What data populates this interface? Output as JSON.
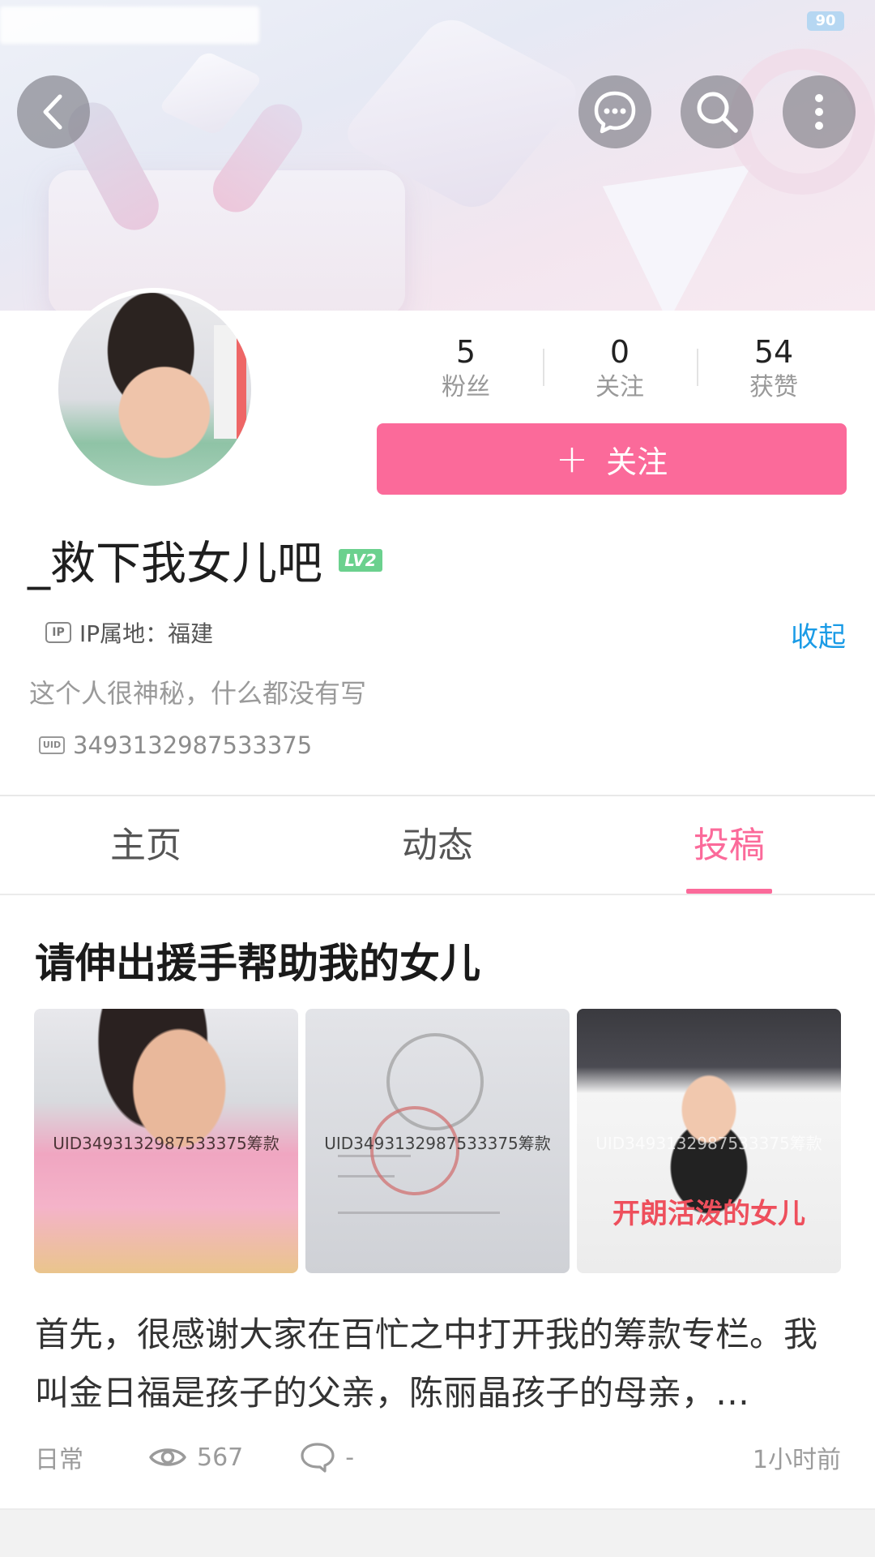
{
  "status_bar": {
    "battery": "90"
  },
  "header": {
    "icons": [
      "back-icon",
      "message-icon",
      "search-icon",
      "more-icon"
    ]
  },
  "profile": {
    "stats": [
      {
        "value": "5",
        "label": "粉丝"
      },
      {
        "value": "0",
        "label": "关注"
      },
      {
        "value": "54",
        "label": "获赞"
      }
    ],
    "follow_button": {
      "icon": "+",
      "label": "关注"
    },
    "username": "_救下我女儿吧",
    "level": "LV2",
    "ip_icon": "IP",
    "ip_location": "IP属地：福建",
    "collapse_label": "收起",
    "bio": "这个人很神秘，什么都没有写",
    "uid_icon": "UID",
    "uid": "3493132987533375"
  },
  "tabs": [
    {
      "label": "主页",
      "active": false
    },
    {
      "label": "动态",
      "active": false
    },
    {
      "label": "投稿",
      "active": true
    }
  ],
  "post": {
    "title": "请伸出援手帮助我的女儿",
    "images": [
      {
        "watermark": "UID3493132987533375筹款",
        "caption": ""
      },
      {
        "watermark": "UID3493132987533375筹款",
        "caption": ""
      },
      {
        "watermark": "UID3493132987533375筹款",
        "caption": "开朗活泼的女儿"
      }
    ],
    "excerpt": "首先，很感谢大家在百忙之中打开我的筹款专栏。我叫金日福是孩子的父亲，陈丽晶孩子的母亲，…",
    "category": "日常",
    "views": "567",
    "comments": "-",
    "time": "1小时前"
  },
  "colors": {
    "accent_pink": "#fb6a9a",
    "link_blue": "#1a9be6",
    "level_green": "#6bd18e"
  }
}
